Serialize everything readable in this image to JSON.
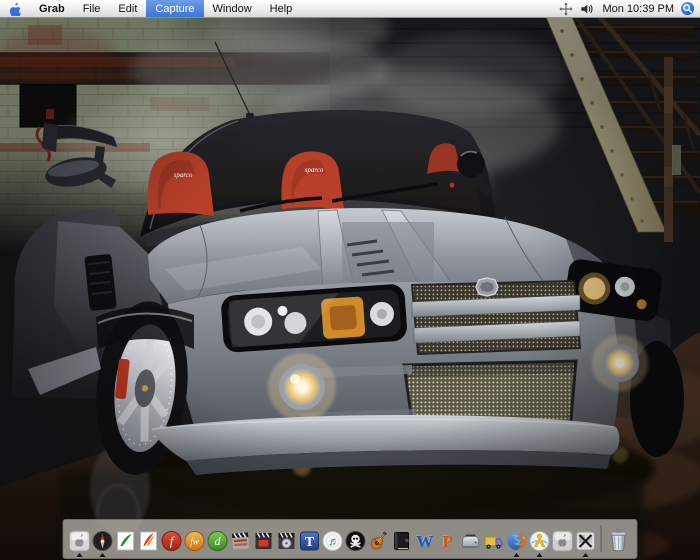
{
  "menubar": {
    "items": [
      "Grab",
      "File",
      "Edit",
      "Capture",
      "Window",
      "Help"
    ],
    "active_item": "Capture",
    "clock": "Mon 10:39 PM",
    "apple_logo_color": "#2f72dd",
    "highlight_color": "#3a76d4",
    "spotlight_color": "#1d63d6",
    "status_icons": [
      "move-cross-icon",
      "volume-icon",
      "spotlight-icon"
    ]
  },
  "wallpaper": {
    "description": "Silver MG XPower SV sports car, front three-quarter view, in a steamy industrial warehouse with pale green glazed brick wall, rusty metal staircase and wet rust-brown floor",
    "seat_brand_text": "sparco",
    "colors": {
      "wall_green": "#b2bc9e",
      "brick_band": "#35291f",
      "car_silver": "#9aa0a8",
      "seat_red": "#b8402a",
      "stair_paint": "#ddd7b8",
      "floor_rust": "#573b2b",
      "fog_glow": "#f0d9a0"
    }
  },
  "dock": {
    "items": [
      {
        "label": "apple-box",
        "running": true
      },
      {
        "label": "compass",
        "running": true
      },
      {
        "label": "document-green-feather",
        "running": false
      },
      {
        "label": "document-red-feather",
        "running": false
      },
      {
        "label": "flash-f",
        "running": false
      },
      {
        "label": "fireworks-fw",
        "running": false
      },
      {
        "label": "dreamweaver-d",
        "running": false
      },
      {
        "label": "clapperboard-silver",
        "running": false
      },
      {
        "label": "clapperboard-red",
        "running": false
      },
      {
        "label": "clapperboard-disc",
        "running": false
      },
      {
        "label": "blue-t",
        "running": false
      },
      {
        "label": "music-cd",
        "running": false
      },
      {
        "label": "skull-crossbones",
        "running": false
      },
      {
        "label": "guitar",
        "running": false
      },
      {
        "label": "black-book",
        "running": false
      },
      {
        "label": "word-w",
        "running": false
      },
      {
        "label": "powerpoint-p",
        "running": false
      },
      {
        "label": "toaster",
        "running": false
      },
      {
        "label": "truck",
        "running": false
      },
      {
        "label": "firefox",
        "running": true
      },
      {
        "label": "aim-man",
        "running": true
      },
      {
        "label": "apple-box-2",
        "running": false
      },
      {
        "label": "crossed-x-app",
        "running": true
      }
    ],
    "trash_label": "Trash"
  }
}
